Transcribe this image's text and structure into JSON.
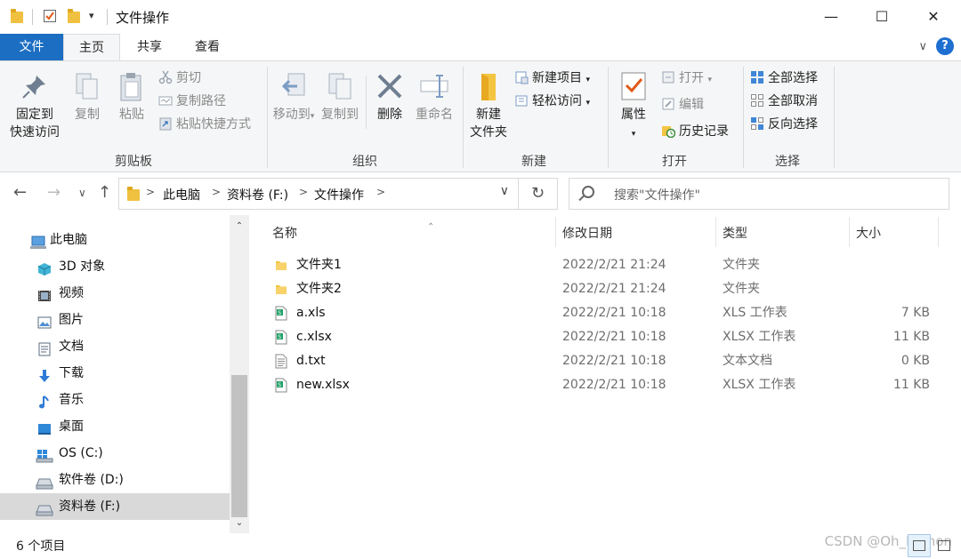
{
  "window": {
    "title": "文件操作",
    "minimize_glyph": "—",
    "maximize_glyph": "☐",
    "close_glyph": "✕",
    "qat_dropdown_glyph": "▾"
  },
  "ribbon_tabs": [
    "文件",
    "主页",
    "共享",
    "查看"
  ],
  "ribbon_collapse_glyph": "∨",
  "help_glyph": "?",
  "ribbon": {
    "clipboard": {
      "label": "剪贴板",
      "pin": [
        "固定到",
        "快速访问"
      ],
      "copy": "复制",
      "paste": "粘贴",
      "cut": "剪切",
      "copy_path": "复制路径",
      "paste_shortcut": "粘贴快捷方式"
    },
    "organize": {
      "label": "组织",
      "move_to": "移动到",
      "copy_to": "复制到",
      "delete": "删除",
      "rename": "重命名"
    },
    "new": {
      "label": "新建",
      "new_folder": [
        "新建",
        "文件夹"
      ],
      "new_item": "新建项目",
      "easy_access": "轻松访问"
    },
    "open": {
      "label": "打开",
      "properties": "属性",
      "open": "打开",
      "edit": "编辑",
      "history": "历史记录"
    },
    "select": {
      "label": "选择",
      "select_all": "全部选择",
      "select_none": "全部取消",
      "invert": "反向选择"
    },
    "dropdown_glyph": "▾"
  },
  "nav": {
    "back_glyph": "←",
    "forward_glyph": "→",
    "recent_glyph": "∨",
    "up_glyph": "↑",
    "crumbs": [
      "此电脑",
      "资料卷 (F:)",
      "文件操作"
    ],
    "crumb_sep": ">",
    "dropdown_glyph": "∨",
    "refresh_glyph": "↻",
    "search_placeholder": "搜索\"文件操作\""
  },
  "sidebar": {
    "items": [
      {
        "label": "此电脑",
        "icon": "pc-icon"
      },
      {
        "label": "3D 对象",
        "icon": "3d-objects-icon"
      },
      {
        "label": "视频",
        "icon": "video-icon"
      },
      {
        "label": "图片",
        "icon": "pictures-icon"
      },
      {
        "label": "文档",
        "icon": "documents-icon"
      },
      {
        "label": "下载",
        "icon": "download-icon"
      },
      {
        "label": "音乐",
        "icon": "music-icon"
      },
      {
        "label": "桌面",
        "icon": "desktop-icon"
      },
      {
        "label": "OS (C:)",
        "icon": "windows-drive-icon"
      },
      {
        "label": "软件卷 (D:)",
        "icon": "drive-icon"
      },
      {
        "label": "资料卷 (F:)",
        "icon": "drive-icon",
        "selected": true
      }
    ],
    "scroll_up_glyph": "⌃",
    "scroll_down_glyph": "⌄"
  },
  "filelist": {
    "columns": [
      "名称",
      "修改日期",
      "类型",
      "大小"
    ],
    "sort_glyph": "⌃",
    "rows": [
      {
        "name": "文件夹1",
        "date": "2022/2/21 21:24",
        "type": "文件夹",
        "size": "",
        "icon": "folder-icon"
      },
      {
        "name": "文件夹2",
        "date": "2022/2/21 21:24",
        "type": "文件夹",
        "size": "",
        "icon": "folder-icon"
      },
      {
        "name": "a.xls",
        "date": "2022/2/21 10:18",
        "type": "XLS 工作表",
        "size": "7 KB",
        "icon": "spreadsheet-icon"
      },
      {
        "name": "c.xlsx",
        "date": "2022/2/21 10:18",
        "type": "XLSX 工作表",
        "size": "11 KB",
        "icon": "spreadsheet-icon"
      },
      {
        "name": "d.txt",
        "date": "2022/2/21 10:18",
        "type": "文本文档",
        "size": "0 KB",
        "icon": "text-file-icon"
      },
      {
        "name": "new.xlsx",
        "date": "2022/2/21 10:18",
        "type": "XLSX 工作表",
        "size": "11 KB",
        "icon": "spreadsheet-icon"
      }
    ]
  },
  "status": {
    "item_count": "6 个项目",
    "watermark": "CSDN @Oh_Python"
  },
  "colors": {
    "accent": "#1b6ec2",
    "folder": "#f0c040",
    "spreadsheet": "#21a366",
    "selected_row": "#d9d9d9"
  }
}
